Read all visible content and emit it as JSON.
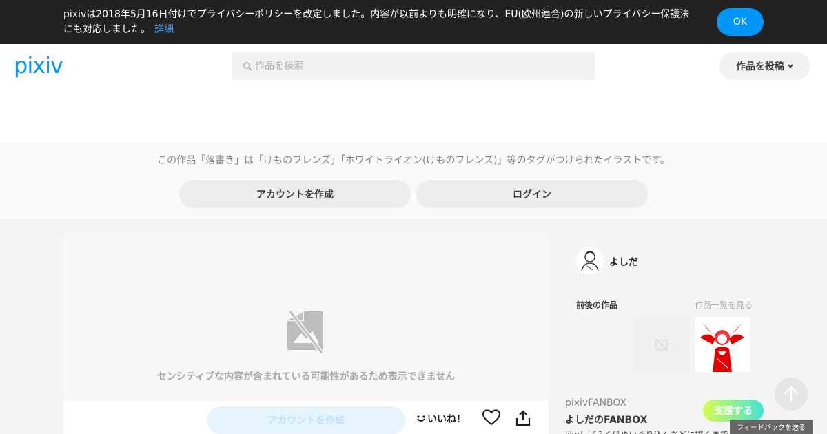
{
  "banner": {
    "text": "pixivは2018年5月16日付けでプライバシーポリシーを改定しました。内容が以前よりも明確になり、EU(欧州連合)の新しいプライバシー保護法にも対応しました。",
    "link_label": "詳細",
    "ok_label": "OK"
  },
  "header": {
    "logo": "pixiv",
    "search_placeholder": "作品を検索",
    "post_label": "作品を投稿"
  },
  "tagband": {
    "text": "この作品「落書き」は「けものフレンズ」「ホワイトライオン(けものフレンズ)」等のタグがつけられたイラストです。",
    "create_label": "アカウントを作成",
    "login_label": "ログイン"
  },
  "artwork": {
    "sensitive_text": "センシティブな内容が含まれている可能性があるため表示できません",
    "create_label": "アカウントを作成",
    "like_label": "いいね！"
  },
  "sidebar": {
    "author_name": "よしだ",
    "prevnext_label": "前後の作品",
    "see_all_label": "作品一覧を見る",
    "fanbox_label": "pixivFANBOX",
    "fanbox_name": "よしだのFANBOX",
    "support_label": "支援する",
    "fanbox_desc": "likeしばらくはぬいぐり込んなどに描くまで"
  },
  "feedback_label": "フィードバックを送る",
  "colors": {
    "accent": "#0096fa",
    "banner_bg": "#222222"
  }
}
